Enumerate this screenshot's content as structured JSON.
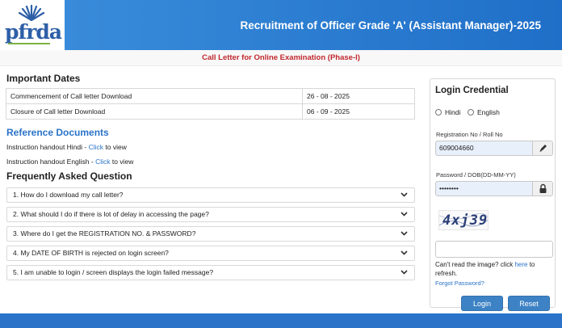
{
  "header": {
    "logo_text": "pfrda",
    "title": "Recruitment of Officer Grade 'A' (Assistant Manager)-2025",
    "logo_accent": "#7cb342"
  },
  "subheader": {
    "text": "Call Letter for Online Examination (Phase-I)"
  },
  "important_dates": {
    "heading": "Important Dates",
    "rows": [
      {
        "label": "Commencement of Call letter Download",
        "date": "26 - 08 - 2025"
      },
      {
        "label": "Closure of Call letter Download",
        "date": "06 - 09 - 2025"
      }
    ]
  },
  "reference_documents": {
    "heading": "Reference Documents",
    "items": [
      {
        "prefix": "Instruction handout Hindi - ",
        "link": "Click",
        "suffix": " to view"
      },
      {
        "prefix": "Instruction handout English - ",
        "link": "Click",
        "suffix": " to view"
      }
    ]
  },
  "faq": {
    "heading": "Frequently Asked Question",
    "items": [
      "1. How do I download my call letter?",
      "2. What should I do if there is lot of delay in accessing the page?",
      "3. Where do I get the REGISTRATION NO. & PASSWORD?",
      "4. My DATE OF BIRTH is rejected on login screen?",
      "5. I am unable to login / screen displays the login failed message?"
    ]
  },
  "login": {
    "title": "Login Credential",
    "language_options": [
      "Hindi",
      "English"
    ],
    "reg_label": "Registration No / Roll No",
    "reg_value": "609004660",
    "pwd_label": "Password / DOB(DD-MM-YY)",
    "pwd_value": "••••••••",
    "captcha_text": "4xj39",
    "cant_read_prefix": "Can't read the image? click ",
    "cant_read_link": "here",
    "cant_read_suffix": " to refresh.",
    "forgot_password": "Forgot Password?",
    "login_button": "Login",
    "reset_button": "Reset"
  },
  "colors": {
    "header_blue": "#1f6fc8",
    "link_blue": "#2a73c8",
    "subheader_red": "#c0272d",
    "button_blue": "#3d82c4"
  }
}
